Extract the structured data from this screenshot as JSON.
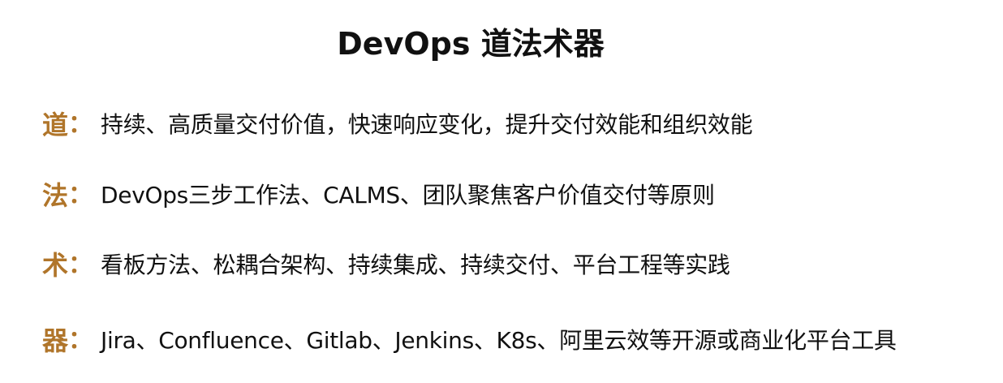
{
  "title": "DevOps 道法术器",
  "colors": {
    "accent": "#b0752a",
    "text": "#111111",
    "background": "#ffffff"
  },
  "rows": [
    {
      "key": "道",
      "colon": "：",
      "text": "持续、高质量交付价值，快速响应变化，提升交付效能和组织效能"
    },
    {
      "key": "法",
      "colon": "：",
      "text": "DevOps三步工作法、CALMS、团队聚焦客户价值交付等原则"
    },
    {
      "key": "术",
      "colon": "：",
      "text": "看板方法、松耦合架构、持续集成、持续交付、平台工程等实践"
    },
    {
      "key": "器",
      "colon": "：",
      "text": "Jira、Confluence、Gitlab、Jenkins、K8s、阿里云效等开源或商业化平台工具"
    }
  ]
}
